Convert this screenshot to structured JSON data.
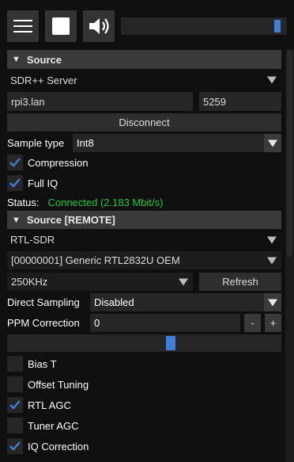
{
  "toolbar": {
    "menu_icon": "menu-icon",
    "stop_icon": "stop-icon",
    "volume_icon": "speaker-icon",
    "volume_level": 0.97
  },
  "source": {
    "header": "Source",
    "source_type": "SDR++ Server",
    "host": "rpi3.lan",
    "port": "5259",
    "disconnect_label": "Disconnect",
    "sample_type_label": "Sample type",
    "sample_type_value": "Int8",
    "compression_label": "Compression",
    "compression_checked": true,
    "full_iq_label": "Full IQ",
    "full_iq_checked": true,
    "status_label": "Status:",
    "status_value": "Connected (2.183 Mbit/s)",
    "status_color": "#1fcc3a"
  },
  "remote": {
    "header": "Source [REMOTE]",
    "driver": "RTL-SDR",
    "device": "[00000001] Generic RTL2832U OEM",
    "sample_rate": "250KHz",
    "refresh_label": "Refresh",
    "direct_sampling_label": "Direct Sampling",
    "direct_sampling_value": "Disabled",
    "ppm_label": "PPM Correction",
    "ppm_value": "0",
    "minus_label": "-",
    "plus_label": "+",
    "gain_level": 0.6,
    "bias_t_label": "Bias T",
    "bias_t_checked": false,
    "offset_tuning_label": "Offset Tuning",
    "offset_tuning_checked": false,
    "rtl_agc_label": "RTL AGC",
    "rtl_agc_checked": true,
    "tuner_agc_label": "Tuner AGC",
    "tuner_agc_checked": false,
    "iq_correction_label": "IQ Correction",
    "iq_correction_checked": true
  },
  "colors": {
    "accent": "#3f7fd8",
    "panel_header": "#3a3a3a",
    "field_bg": "#262626"
  }
}
